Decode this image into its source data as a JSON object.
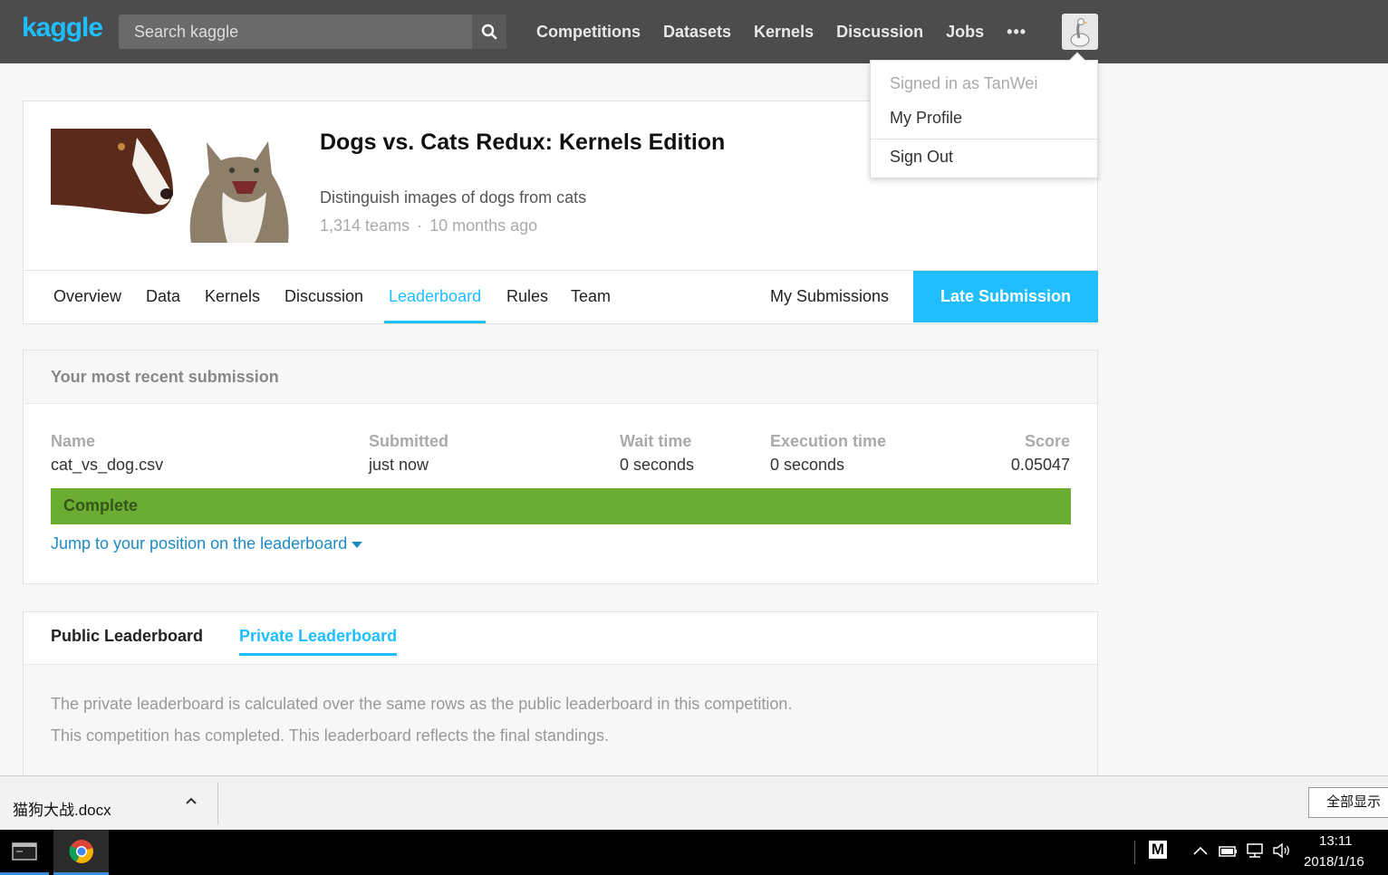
{
  "topnav": {
    "logo": "kaggle",
    "search_placeholder": "Search kaggle",
    "links": [
      "Competitions",
      "Datasets",
      "Kernels",
      "Discussion",
      "Jobs"
    ],
    "more": "•••",
    "avatar_icon": "goose-avatar-icon"
  },
  "dropdown": {
    "signed_in": "Signed in as TanWei",
    "my_profile": "My Profile",
    "sign_out": "Sign Out"
  },
  "competition": {
    "title": "Dogs vs. Cats Redux: Kernels Edition",
    "subtitle": "Distinguish images of dogs from cats",
    "teams": "1,314 teams",
    "separator": "·",
    "age": "10 months ago",
    "tabs": [
      "Overview",
      "Data",
      "Kernels",
      "Discussion",
      "Leaderboard",
      "Rules",
      "Team"
    ],
    "active_tab": "Leaderboard",
    "my_submissions": "My Submissions",
    "late_submission": "Late Submission"
  },
  "submission": {
    "heading": "Your most recent submission",
    "columns": {
      "name_h": "Name",
      "name_v": "cat_vs_dog.csv",
      "submitted_h": "Submitted",
      "submitted_v": "just now",
      "wait_h": "Wait time",
      "wait_v": "0 seconds",
      "exec_h": "Execution time",
      "exec_v": "0 seconds",
      "score_h": "Score",
      "score_v": "0.05047"
    },
    "status": "Complete",
    "status_color": "#6aad32",
    "jump_link": "Jump to your position on the leaderboard"
  },
  "leaderboard": {
    "public_tab": "Public Leaderboard",
    "private_tab": "Private Leaderboard",
    "line1": "The private leaderboard is calculated over the same rows as the public leaderboard in this competition.",
    "line2": "This competition has completed. This leaderboard reflects the final standings."
  },
  "download_bar": {
    "file": "猫狗大战.docx",
    "show_all": "全部显示"
  },
  "taskbar": {
    "time": "13:11",
    "date": "2018/1/16",
    "tray_m": "M"
  },
  "colors": {
    "accent": "#20beff",
    "nav_bg": "#4c4c4c",
    "link": "#1f8bc4"
  }
}
